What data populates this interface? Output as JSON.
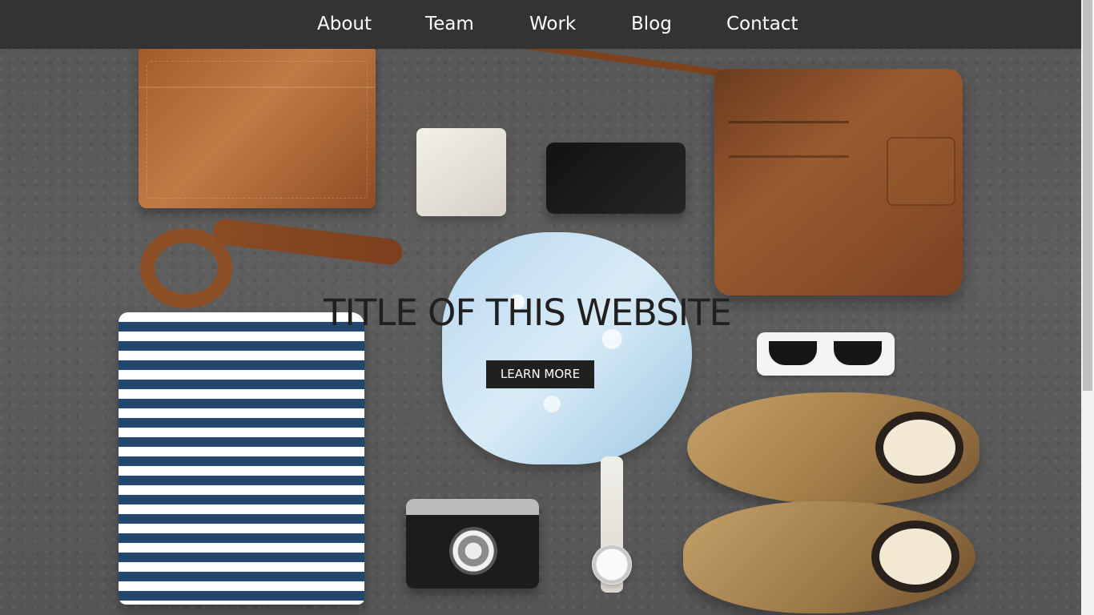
{
  "nav": {
    "items": [
      {
        "label": "About"
      },
      {
        "label": "Team"
      },
      {
        "label": "Work"
      },
      {
        "label": "Blog"
      },
      {
        "label": "Contact"
      }
    ]
  },
  "hero": {
    "title": "TITLE OF THIS WEBSITE",
    "cta_label": "LEARN MORE"
  },
  "colors": {
    "navbar_background": "#333333",
    "title_text": "#202020",
    "button_background": "#202020",
    "button_text": "#ffffff"
  }
}
